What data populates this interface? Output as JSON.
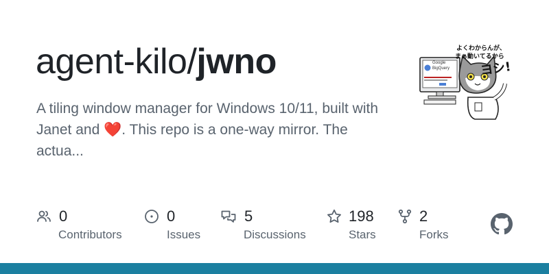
{
  "repo": {
    "owner": "agent-kilo/",
    "name": "jwno",
    "description_before": "A tiling window manager for Windows 10/11, built with Janet and ",
    "heart": "❤️",
    "description_after": ". This repo is a one-way mirror. The actua..."
  },
  "stats": [
    {
      "value": "0",
      "label": "Contributors",
      "icon": "people-icon"
    },
    {
      "value": "0",
      "label": "Issues",
      "icon": "issue-opened-icon"
    },
    {
      "value": "5",
      "label": "Discussions",
      "icon": "comment-discussion-icon"
    },
    {
      "value": "198",
      "label": "Stars",
      "icon": "star-icon"
    },
    {
      "value": "2",
      "label": "Forks",
      "icon": "repo-forked-icon"
    }
  ],
  "avatar": {
    "caption_line1": "よくわからんが、",
    "caption_line2": "まぁ動いてるから",
    "caption_big": "ヨシ!",
    "screen_text_1": "Google",
    "screen_text_2": "BigQuery"
  },
  "colors": {
    "accent_bar": "#1b7fa0",
    "text_primary": "#1f2328",
    "text_muted": "#59636e"
  }
}
